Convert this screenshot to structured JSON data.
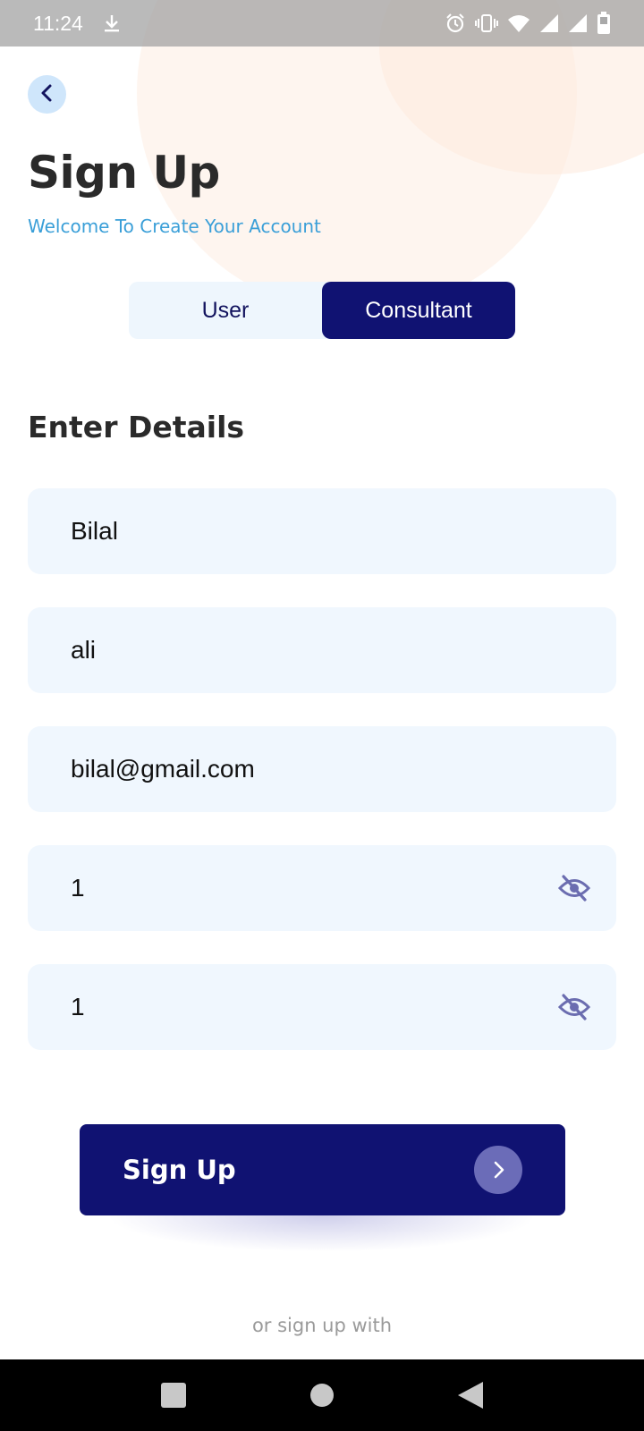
{
  "status_bar": {
    "time": "11:24",
    "icons": [
      "download-icon",
      "alarm-icon",
      "vibrate-icon",
      "wifi-icon",
      "signal-icon",
      "signal-icon",
      "battery-icon"
    ]
  },
  "header": {
    "back_icon": "chevron-left-icon",
    "title": "Sign Up",
    "subtitle": "Welcome To Create Your Account"
  },
  "account_type": {
    "options": [
      "User",
      "Consultant"
    ],
    "selected": "Consultant"
  },
  "form": {
    "section_title": "Enter Details",
    "fields": [
      {
        "value": "Bilal"
      },
      {
        "value": "ali"
      },
      {
        "value": "bilal@gmail.com"
      },
      {
        "value": "1",
        "icon": "eye-off-icon"
      },
      {
        "value": "1",
        "icon": "eye-off-icon"
      }
    ]
  },
  "signup_button": {
    "label": "Sign Up",
    "icon": "chevron-right-icon"
  },
  "alt_signup_text": "or sign up with",
  "nav_bar": {
    "icons": [
      "recents-icon",
      "home-icon",
      "back-icon"
    ]
  },
  "colors": {
    "primary": "#101272",
    "accent_text": "#3a9fd8",
    "field_bg": "#f0f7fe",
    "back_button_bg": "#cfe6fb"
  }
}
